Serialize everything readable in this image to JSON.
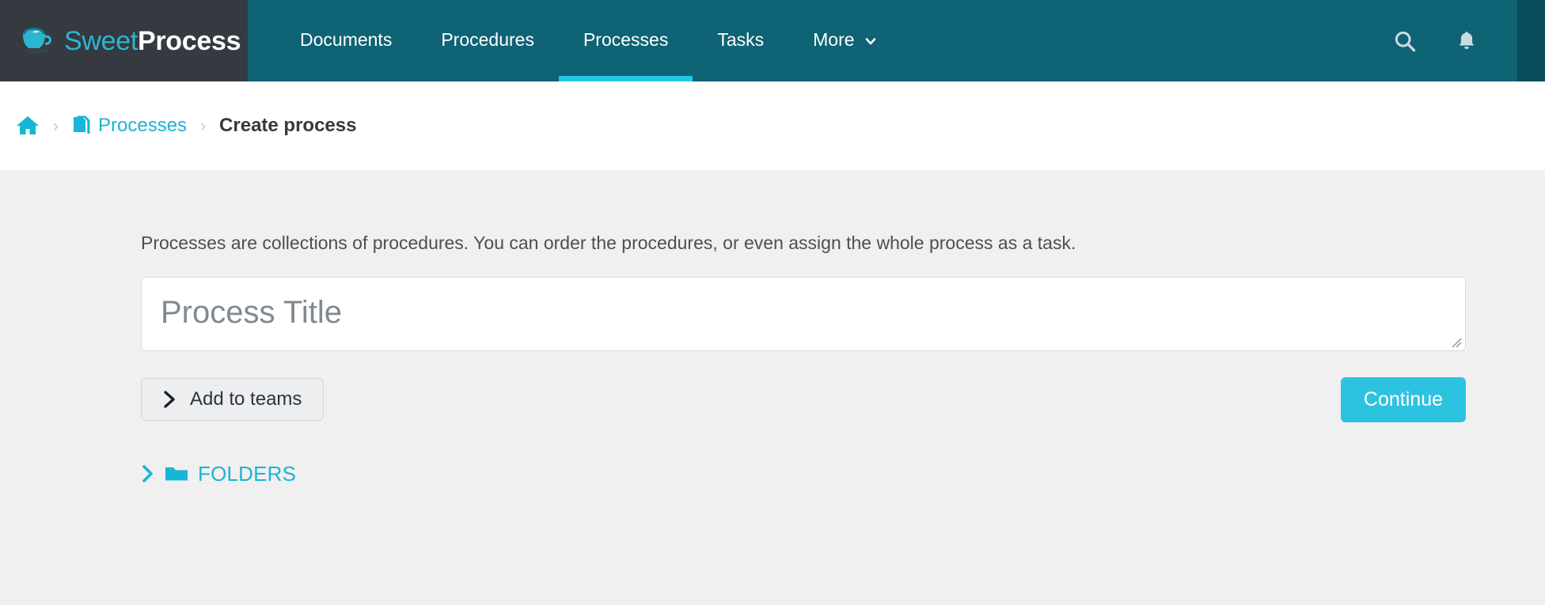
{
  "brand": {
    "name_part1": "Sweet",
    "name_part2": "Process",
    "logo_icon": "coffee-cup-icon"
  },
  "nav": {
    "items": [
      {
        "label": "Documents",
        "active": false
      },
      {
        "label": "Procedures",
        "active": false
      },
      {
        "label": "Processes",
        "active": true
      },
      {
        "label": "Tasks",
        "active": false
      },
      {
        "label": "More",
        "active": false,
        "has_dropdown": true
      }
    ],
    "search_icon": "search-icon",
    "notifications_icon": "bell-icon"
  },
  "breadcrumb": {
    "home_icon": "home-icon",
    "separator": "›",
    "processes_icon": "documents-copy-icon",
    "processes_label": "Processes",
    "current_label": "Create process"
  },
  "main": {
    "lead_text": "Processes are collections of procedures. You can order the procedures, or even assign the whole process as a task.",
    "title_input": {
      "value": "",
      "placeholder": "Process Title"
    },
    "add_to_teams": {
      "label": "Add to teams",
      "icon": "chevron-right-icon"
    },
    "continue": {
      "label": "Continue"
    },
    "folders": {
      "label": "FOLDERS",
      "chevron_icon": "chevron-right-icon",
      "folder_icon": "folder-icon"
    }
  },
  "colors": {
    "nav_teal": "#0e6374",
    "nav_teal_dark": "#0a4d5c",
    "brand_dark": "#343a40",
    "accent_cyan": "#22c7e8",
    "link_cyan": "#17b6d6",
    "page_bg": "#f0f0f0"
  }
}
